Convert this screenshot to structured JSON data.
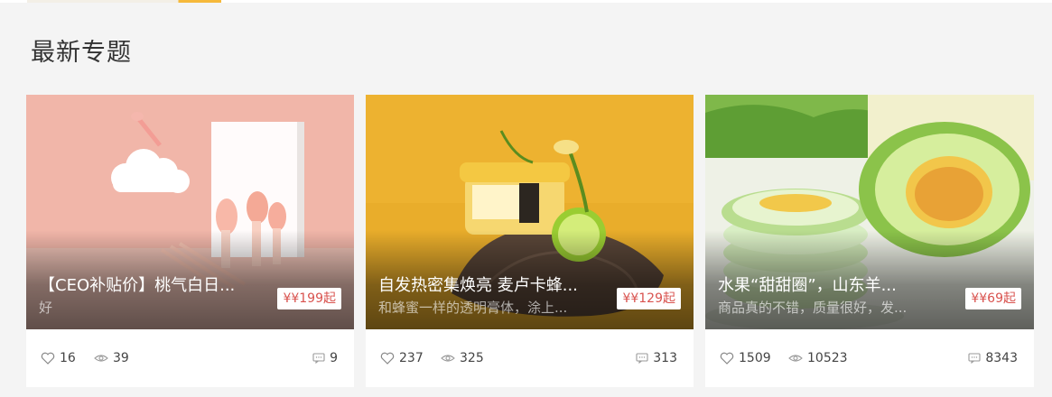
{
  "header": {
    "title": "最新专题"
  },
  "cards": [
    {
      "title": "【CEO补贴价】桃气白日...",
      "description": "好",
      "price": "¥¥199起",
      "likes": "16",
      "views": "39",
      "comments": "9",
      "image": "pink-makeup-brushes"
    },
    {
      "title": "自发热密集焕亮 麦卢卡蜂...",
      "description": "和蜂蜜一样的透明膏体，涂上...",
      "price": "¥¥129起",
      "likes": "237",
      "views": "325",
      "comments": "313",
      "image": "honey-mask-jar-with-lime"
    },
    {
      "title": "水果“甜甜圈”，山东羊...",
      "description": "商品真的不错，质量很好，发...",
      "price": "¥¥69起",
      "likes": "1509",
      "views": "10523",
      "comments": "8343",
      "image": "sliced-melon"
    }
  ],
  "icons": {
    "likes": "heart-icon",
    "views": "eye-icon",
    "comments": "comment-icon"
  },
  "colors": {
    "price": "#d9534f",
    "background": "#f4f4f4",
    "accent": "#f6b93b"
  }
}
